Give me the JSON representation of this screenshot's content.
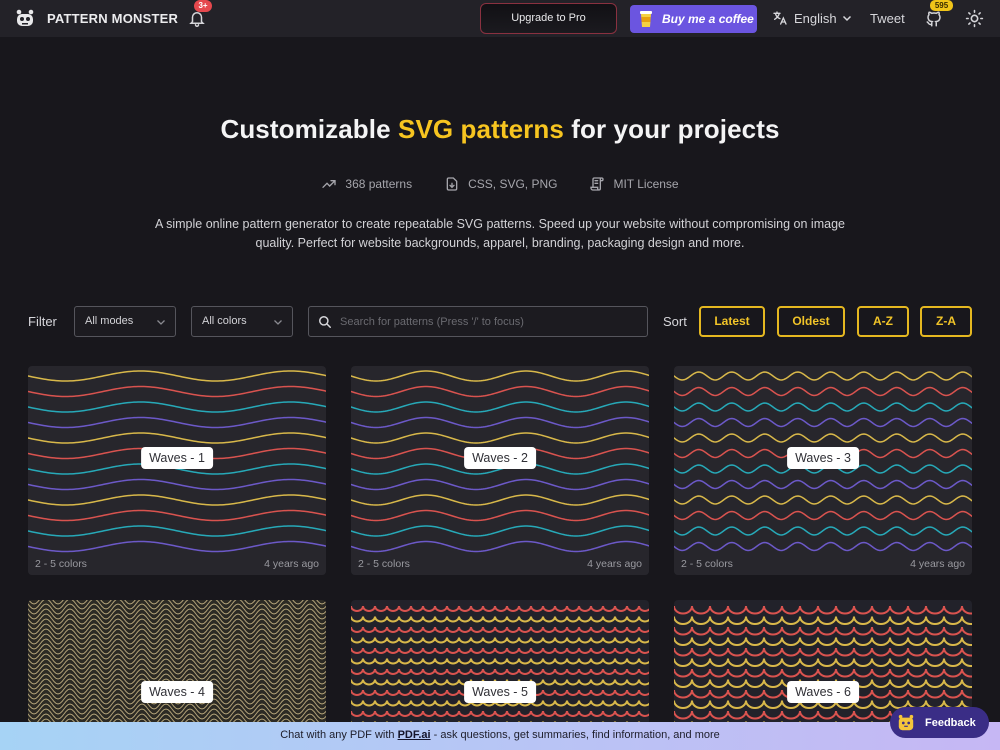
{
  "header": {
    "brand": "PATTERN MONSTER",
    "notification_badge": "3+",
    "upgrade_label": "Upgrade to Pro",
    "coffee_label": "Buy me a coffee",
    "language": "English",
    "tweet_label": "Tweet",
    "github_stars": "595"
  },
  "hero": {
    "title_prefix": "Customizable ",
    "title_accent": "SVG patterns",
    "title_suffix": " for your projects",
    "stats": [
      {
        "icon": "trending-up-icon",
        "label": "368 patterns"
      },
      {
        "icon": "file-download-icon",
        "label": "CSS, SVG, PNG"
      },
      {
        "icon": "license-icon",
        "label": "MIT License"
      }
    ],
    "description": "A simple online pattern generator to create repeatable SVG patterns. Speed up your website without compromising on image quality. Perfect for website backgrounds, apparel, branding, packaging design and more."
  },
  "filters": {
    "filter_label": "Filter",
    "mode_selected": "All modes",
    "color_selected": "All colors",
    "search_placeholder": "Search for patterns (Press '/' to focus)",
    "sort_label": "Sort",
    "sort_options": [
      "Latest",
      "Oldest",
      "A-Z",
      "Z-A"
    ]
  },
  "colors": {
    "accent": "#f7c520",
    "wave_yellow": "#d8b84a",
    "wave_red": "#d9534f",
    "wave_teal": "#27a9b8",
    "wave_purple": "#6c59c8",
    "wave_tan": "#b4a47a",
    "card_bg": "#27262c"
  },
  "patterns": [
    {
      "name": "Waves - 1",
      "colors": "2 - 5 colors",
      "age": "4 years ago"
    },
    {
      "name": "Waves - 2",
      "colors": "2 - 5 colors",
      "age": "4 years ago"
    },
    {
      "name": "Waves - 3",
      "colors": "2 - 5 colors",
      "age": "4 years ago"
    },
    {
      "name": "Waves - 4"
    },
    {
      "name": "Waves - 5"
    },
    {
      "name": "Waves - 6"
    }
  ],
  "banner": {
    "prefix": "Chat with any PDF with ",
    "link": "PDF.ai",
    "suffix": " - ask questions, get summaries, find information, and more"
  },
  "feedback_label": "Feedback"
}
